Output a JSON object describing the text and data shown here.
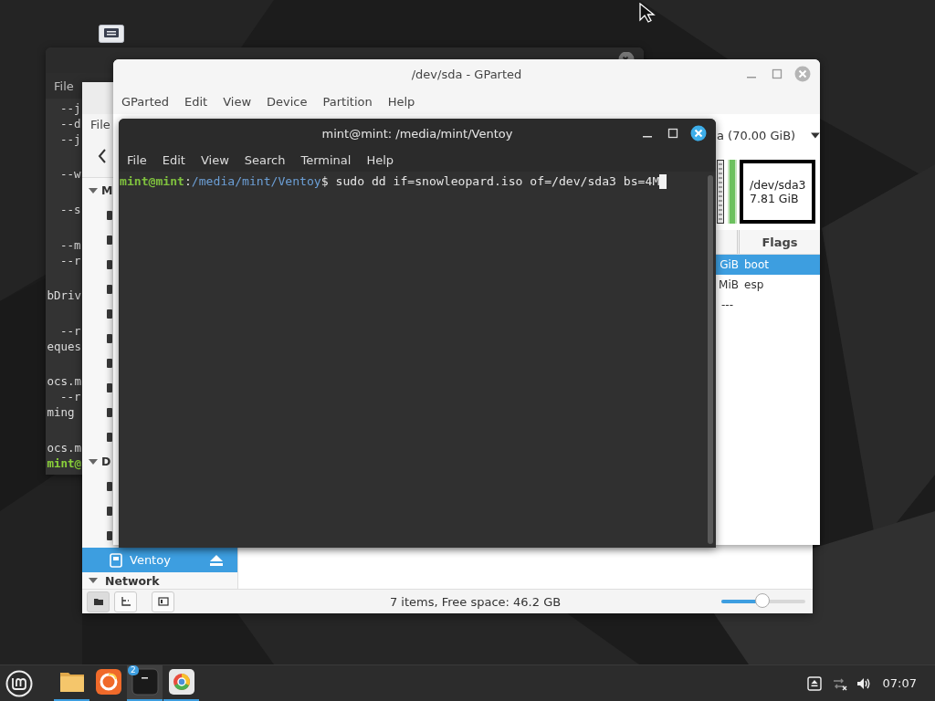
{
  "back_terminal": {
    "menu": [
      "File"
    ],
    "blocks": [
      [
        {
          "text": "--j",
          "indented": true,
          "kind": "output"
        },
        {
          "text": "--d",
          "indented": true,
          "kind": "output"
        },
        {
          "text": "--j",
          "indented": true,
          "kind": "output"
        }
      ],
      [
        {
          "text": "--w",
          "indented": true,
          "kind": "output"
        }
      ],
      [
        {
          "text": "--s",
          "indented": true,
          "kind": "output"
        }
      ],
      [
        {
          "text": "--m",
          "indented": true,
          "kind": "output"
        },
        {
          "text": "--r",
          "indented": true,
          "kind": "output"
        }
      ],
      [
        {
          "text": "bDriv",
          "indented": false,
          "kind": "output"
        }
      ],
      [
        {
          "text": "--r",
          "indented": true,
          "kind": "output"
        },
        {
          "text": "eques",
          "indented": false,
          "kind": "output"
        }
      ],
      [
        {
          "text": "ocs.m",
          "indented": false,
          "kind": "output"
        },
        {
          "text": "--r",
          "indented": true,
          "kind": "output"
        },
        {
          "text": "ming",
          "indented": false,
          "kind": "output"
        }
      ],
      [
        {
          "text": "ocs.m",
          "indented": false,
          "kind": "output"
        },
        {
          "text": "mint@",
          "indented": false,
          "kind": "prompt"
        }
      ]
    ]
  },
  "file_manager": {
    "menu": [
      "File"
    ],
    "sidebar": [
      {
        "label": "M",
        "expanded": true,
        "items": [
          {
            "selected": false
          },
          {
            "selected": false
          },
          {
            "selected": false
          },
          {
            "selected": false
          },
          {
            "selected": false
          },
          {
            "selected": false
          },
          {
            "selected": false
          },
          {
            "selected": false
          },
          {
            "selected": false
          },
          {
            "selected": false
          }
        ]
      },
      {
        "label": "D",
        "expanded": true,
        "items": [
          {
            "selected": false
          },
          {
            "selected": false
          },
          {
            "selected": false
          },
          {
            "label": "Ventoy",
            "selected": true,
            "ejectable": true
          }
        ]
      },
      {
        "label": "Network",
        "expanded": true
      }
    ],
    "status_buttons": [
      {
        "kind": "places",
        "selected": true
      },
      {
        "kind": "tree",
        "selected": false
      },
      {
        "kind": "sidebar",
        "selected": false
      }
    ],
    "status": "7 items, Free space: 46.2 GB",
    "zoom": {
      "level": 0.49
    }
  },
  "gparted": {
    "title": "/dev/sda - GParted",
    "menu": [
      "GParted",
      "Edit",
      "View",
      "Device",
      "Partition",
      "Help"
    ],
    "device": "a (70.00 GiB)",
    "partition": {
      "name": "/dev/sda3",
      "size": "7.81 GiB"
    },
    "columns": [
      "Flags"
    ],
    "rows": [
      {
        "column_1": "GiB",
        "flags": "boot",
        "selected": true
      },
      {
        "column_1": "MiB",
        "flags": "esp",
        "selected": false
      },
      {
        "column_1": "---",
        "selected": false
      }
    ]
  },
  "terminal": {
    "title": "mint@mint: /media/mint/Ventoy",
    "menu": [
      "File",
      "Edit",
      "View",
      "Search",
      "Terminal",
      "Help"
    ],
    "prompt": {
      "user": "mint@mint",
      "separator": ":",
      "path": "/media/mint/Ventoy",
      "symbol": "$",
      "command": " sudo dd if=snowleopard.iso of=/dev/sda3 bs=4M"
    }
  },
  "taskbar": {
    "apps": [
      {
        "kind": "files",
        "running": true,
        "active": false
      },
      {
        "kind": "firefox",
        "running": false,
        "active": false
      },
      {
        "kind": "terminal",
        "running": true,
        "active": true,
        "badge": "2"
      },
      {
        "kind": "web",
        "running": true,
        "active": false
      }
    ],
    "tray": [
      {
        "kind": "removable"
      },
      {
        "kind": "network"
      },
      {
        "kind": "volume"
      }
    ],
    "clock": "07:07"
  }
}
